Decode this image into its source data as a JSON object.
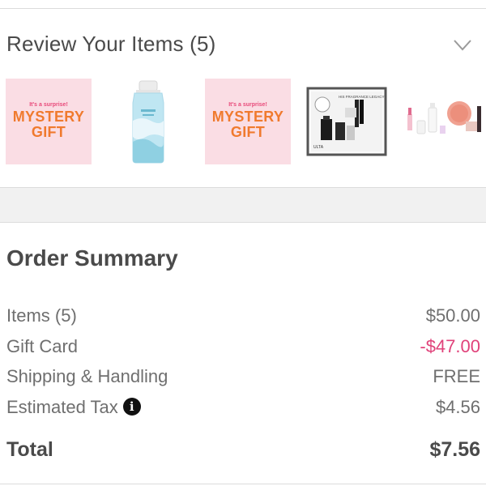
{
  "review": {
    "title": "Review Your Items (5)",
    "items": [
      {
        "icon": "mystery-gift-image",
        "small": "It's a surprise!",
        "big1": "MYSTERY",
        "big2": "GIFT"
      },
      {
        "icon": "toner-bottle-image"
      },
      {
        "icon": "mystery-gift-image",
        "small": "It's a surprise!",
        "big1": "MYSTERY",
        "big2": "GIFT"
      },
      {
        "icon": "fragrance-legacy-set-image",
        "box_text": "HIS FRAGRANCE LEGACY",
        "brand": "ULTA"
      },
      {
        "icon": "makeup-kit-image"
      }
    ]
  },
  "summary": {
    "title": "Order Summary",
    "rows": [
      {
        "label": "Items (5)",
        "value": "$50.00"
      },
      {
        "label": "Gift Card",
        "value": "-$47.00"
      },
      {
        "label": "Shipping & Handling",
        "value": "FREE"
      },
      {
        "label": "Estimated Tax",
        "value": "$4.56"
      }
    ],
    "total_label": "Total",
    "total_value": "$7.56",
    "colors": {
      "discount": "#e0427a",
      "mystery_bg": "#fadde4",
      "mystery_text": "#f07a2e"
    }
  }
}
